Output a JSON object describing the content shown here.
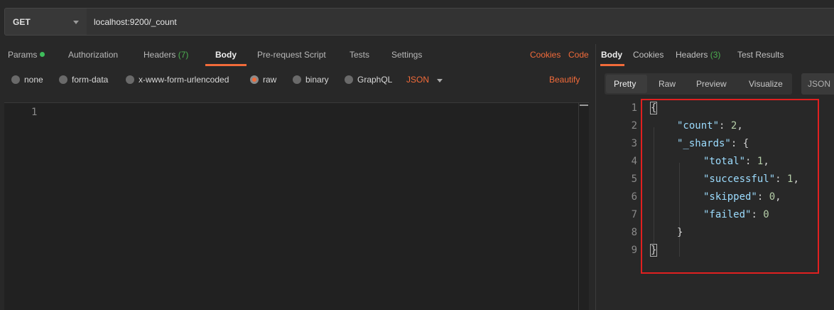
{
  "request": {
    "method": "GET",
    "url": "localhost:9200/_count"
  },
  "request_tabs": {
    "params": "Params",
    "authorization": "Authorization",
    "headers": "Headers",
    "headers_count": "(7)",
    "body": "Body",
    "prerequest": "Pre-request Script",
    "tests": "Tests",
    "settings": "Settings",
    "cookies": "Cookies",
    "code": "Code"
  },
  "body_types": {
    "none": "none",
    "form_data": "form-data",
    "urlencoded": "x-www-form-urlencoded",
    "raw": "raw",
    "binary": "binary",
    "graphql": "GraphQL",
    "selected": "raw",
    "format": "JSON",
    "beautify": "Beautify"
  },
  "editor": {
    "line_numbers": [
      "1"
    ]
  },
  "response_tabs": {
    "body": "Body",
    "cookies": "Cookies",
    "headers": "Headers",
    "headers_count": "(3)",
    "test_results": "Test Results"
  },
  "view_modes": {
    "pretty": "Pretty",
    "raw": "Raw",
    "preview": "Preview",
    "visualize": "Visualize",
    "format": "JSON"
  },
  "response": {
    "lines": [
      {
        "num": "1",
        "key": "",
        "value": "",
        "open": "{",
        "close": ""
      },
      {
        "num": "2",
        "key": "\"count\"",
        "value": "2",
        "open": "",
        "close": ","
      },
      {
        "num": "3",
        "key": "\"_shards\"",
        "value": "",
        "open": "{",
        "close": ""
      },
      {
        "num": "4",
        "key": "\"total\"",
        "value": "1",
        "open": "",
        "close": ","
      },
      {
        "num": "5",
        "key": "\"successful\"",
        "value": "1",
        "open": "",
        "close": ","
      },
      {
        "num": "6",
        "key": "\"skipped\"",
        "value": "0",
        "open": "",
        "close": ","
      },
      {
        "num": "7",
        "key": "\"failed\"",
        "value": "0",
        "open": "",
        "close": ""
      },
      {
        "num": "8",
        "key": "",
        "value": "",
        "open": "}",
        "close": ""
      },
      {
        "num": "9",
        "key": "",
        "value": "",
        "open": "}",
        "close": ""
      }
    ]
  },
  "colors": {
    "accent": "#f26b3a",
    "highlight": "#e02020",
    "status_ok": "#3ebd5b"
  }
}
